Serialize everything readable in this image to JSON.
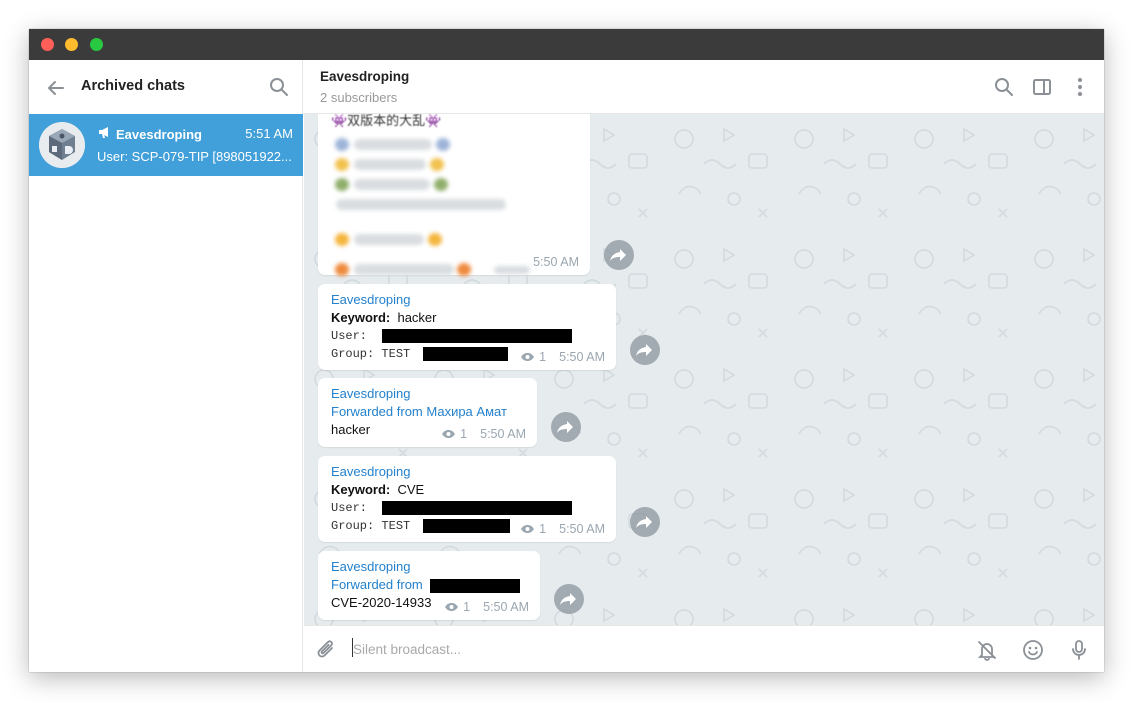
{
  "sidebar": {
    "title": "Archived chats",
    "chats": [
      {
        "name": "Eavesdroping",
        "time": "5:51 AM",
        "preview": "User: SCP-079-TIP [898051922...",
        "icon": "megaphone-icon"
      }
    ]
  },
  "channel": {
    "title": "Eavesdroping",
    "subtitle": "2 subscribers"
  },
  "messages": [
    {
      "type": "blurred",
      "heading": "👾双版本的大乱👾",
      "time": "5:50 AM"
    },
    {
      "type": "keyword",
      "author": "Eavesdroping",
      "keyword_label": "Keyword:",
      "keyword": "hacker",
      "user_label": "User:",
      "group_label": "Group:",
      "group_value": "TEST",
      "views": "1",
      "time": "5:50 AM"
    },
    {
      "type": "forward",
      "author": "Eavesdroping",
      "forwarded": "Forwarded from Махира Амат",
      "text": "hacker",
      "views": "1",
      "time": "5:50 AM"
    },
    {
      "type": "keyword",
      "author": "Eavesdroping",
      "keyword_label": "Keyword:",
      "keyword": "CVE",
      "user_label": "User:",
      "group_label": "Group:",
      "group_value": "TEST",
      "views": "1",
      "time": "5:50 AM"
    },
    {
      "type": "forward",
      "author": "Eavesdroping",
      "forwarded": "Forwarded from",
      "text": "CVE-2020-14933",
      "views": "1",
      "time": "5:50 AM"
    }
  ],
  "composer": {
    "placeholder": "Silent broadcast..."
  },
  "colors": {
    "accent": "#419fd9",
    "link": "#2481cc",
    "chat_background": "#e6ebee",
    "titlebar": "#3b3b3b"
  },
  "icons": [
    "back-arrow-icon",
    "search-icon",
    "sidebar-toggle-icon",
    "more-vertical-icon",
    "share-icon",
    "eye-icon",
    "paperclip-icon",
    "bell-off-icon",
    "emoji-icon",
    "microphone-icon"
  ]
}
